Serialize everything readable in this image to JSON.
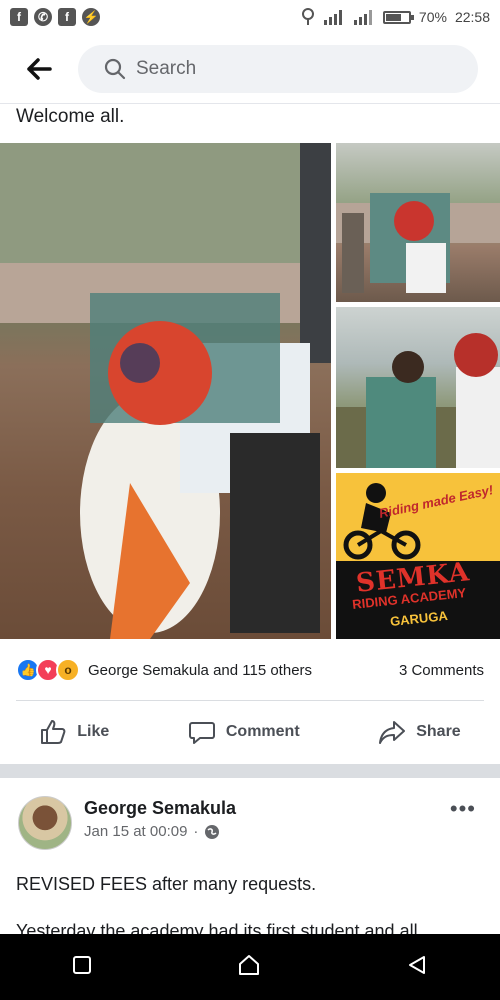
{
  "status_bar": {
    "notification_icons": [
      "facebook-icon",
      "whatsapp-icon",
      "facebook-icon",
      "messenger-icon"
    ],
    "battery_percent": "70%",
    "battery_level": 0.7,
    "time": "22:58"
  },
  "search": {
    "placeholder": "Search"
  },
  "post": {
    "text": "Welcome all.",
    "promo": {
      "riding": "Riding made Easy!",
      "semka": "SEMKA",
      "academy": "RIDING ACADEMY",
      "garuga": "GARUGA"
    },
    "reactions": {
      "icons": [
        "like-reaction-icon",
        "love-reaction-icon",
        "wow-reaction-icon"
      ],
      "summary": "George Semakula and 115 others",
      "comments": "3 Comments"
    },
    "actions": {
      "like": "Like",
      "comment": "Comment",
      "share": "Share"
    }
  },
  "next_post": {
    "author": "George Semakula",
    "date": "Jan 15 at 00:09",
    "separator": "·",
    "text": "REVISED FEES after many requests.",
    "text_continued": "Yesterday the academy had its first student and all"
  },
  "colors": {
    "accent": "#1877f2",
    "love": "#f33e58",
    "wow": "#f7b125"
  }
}
